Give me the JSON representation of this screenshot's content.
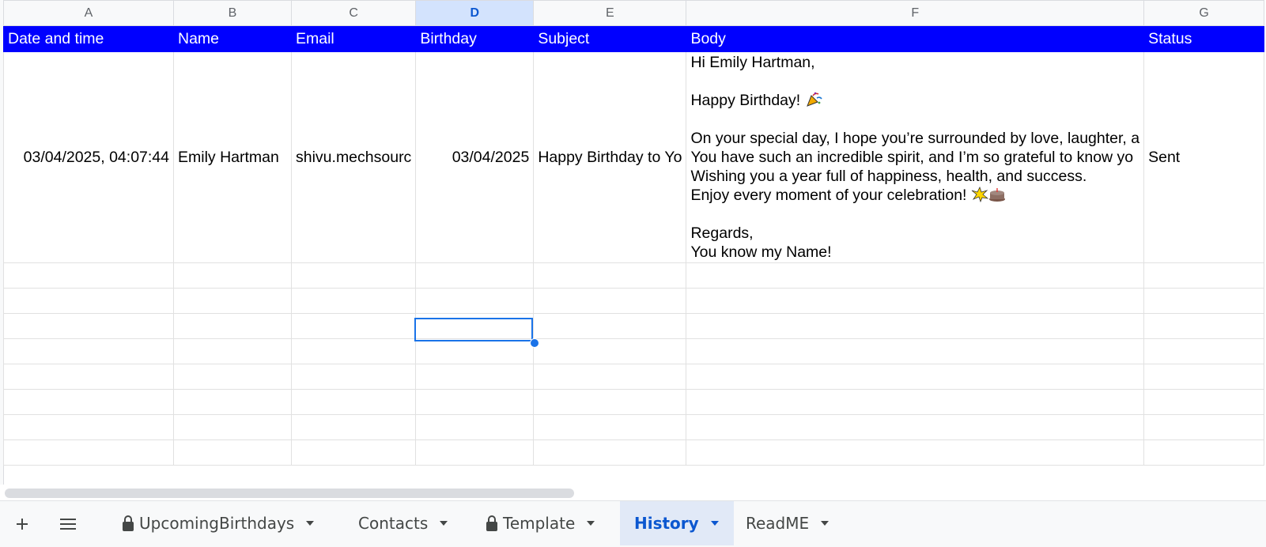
{
  "columns": [
    "A",
    "B",
    "C",
    "D",
    "E",
    "F",
    "G"
  ],
  "header_row": {
    "date_time": "Date and time",
    "name": "Name",
    "email": "Email",
    "birthday": "Birthday",
    "subject": "Subject",
    "body": "Body",
    "status": "Status"
  },
  "row1": {
    "date_time": "03/04/2025, 04:07:44",
    "name": "Emily Hartman",
    "email": "shivu.mechsourc",
    "birthday": "03/04/2025",
    "subject": "Happy Birthday to Yo",
    "body_lines": [
      "Hi Emily Hartman,",
      "",
      "Happy Birthday! ",
      "",
      "On your special day, I hope you’re surrounded by love, laughter, a",
      "You have such an incredible spirit, and I’m so grateful to know yo",
      "Wishing you a year full of happiness, health, and success.",
      "Enjoy every moment of your celebration! ",
      "",
      "Regards,",
      "You know my Name!"
    ],
    "status": "Sent"
  },
  "colors": {
    "header_bg": "#0000ff",
    "header_text": "#ffffff",
    "selection": "#1a73e8",
    "active_tab_bg": "#e1e9f7",
    "active_tab_text": "#0b57d0"
  },
  "selected_cell": "D",
  "tabs": [
    {
      "label": "UpcomingBirthdays",
      "locked": true
    },
    {
      "label": "Contacts",
      "locked": false
    },
    {
      "label": "Template",
      "locked": true
    },
    {
      "label": "History",
      "locked": false,
      "active": true
    },
    {
      "label": "ReadME",
      "locked": false
    }
  ]
}
